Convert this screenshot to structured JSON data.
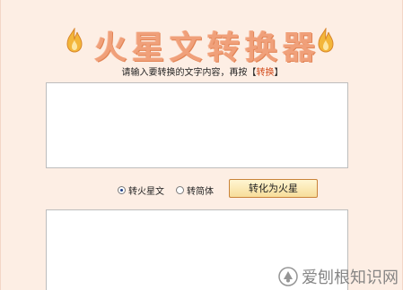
{
  "header": {
    "title": "火星文转换器",
    "left_icon": "flame-icon",
    "right_icon": "flame-icon"
  },
  "instruction": {
    "prefix": "请输入要转换的文字内容，再按【",
    "highlight": "转换",
    "suffix": "】"
  },
  "input": {
    "value": ""
  },
  "options": {
    "radio_mars_label": "转火星文",
    "radio_mars_checked": true,
    "radio_simplified_label": "转简体",
    "radio_simplified_checked": false,
    "convert_button_label": "转化为火星"
  },
  "output": {
    "value": ""
  },
  "watermark": {
    "text": "爱刨根知识网",
    "icon": "watermark-logo-icon"
  },
  "colors": {
    "background": "#fdeee4",
    "title": "#f0a07a",
    "highlight": "#d24a1a",
    "button": "#f7dd9a"
  }
}
